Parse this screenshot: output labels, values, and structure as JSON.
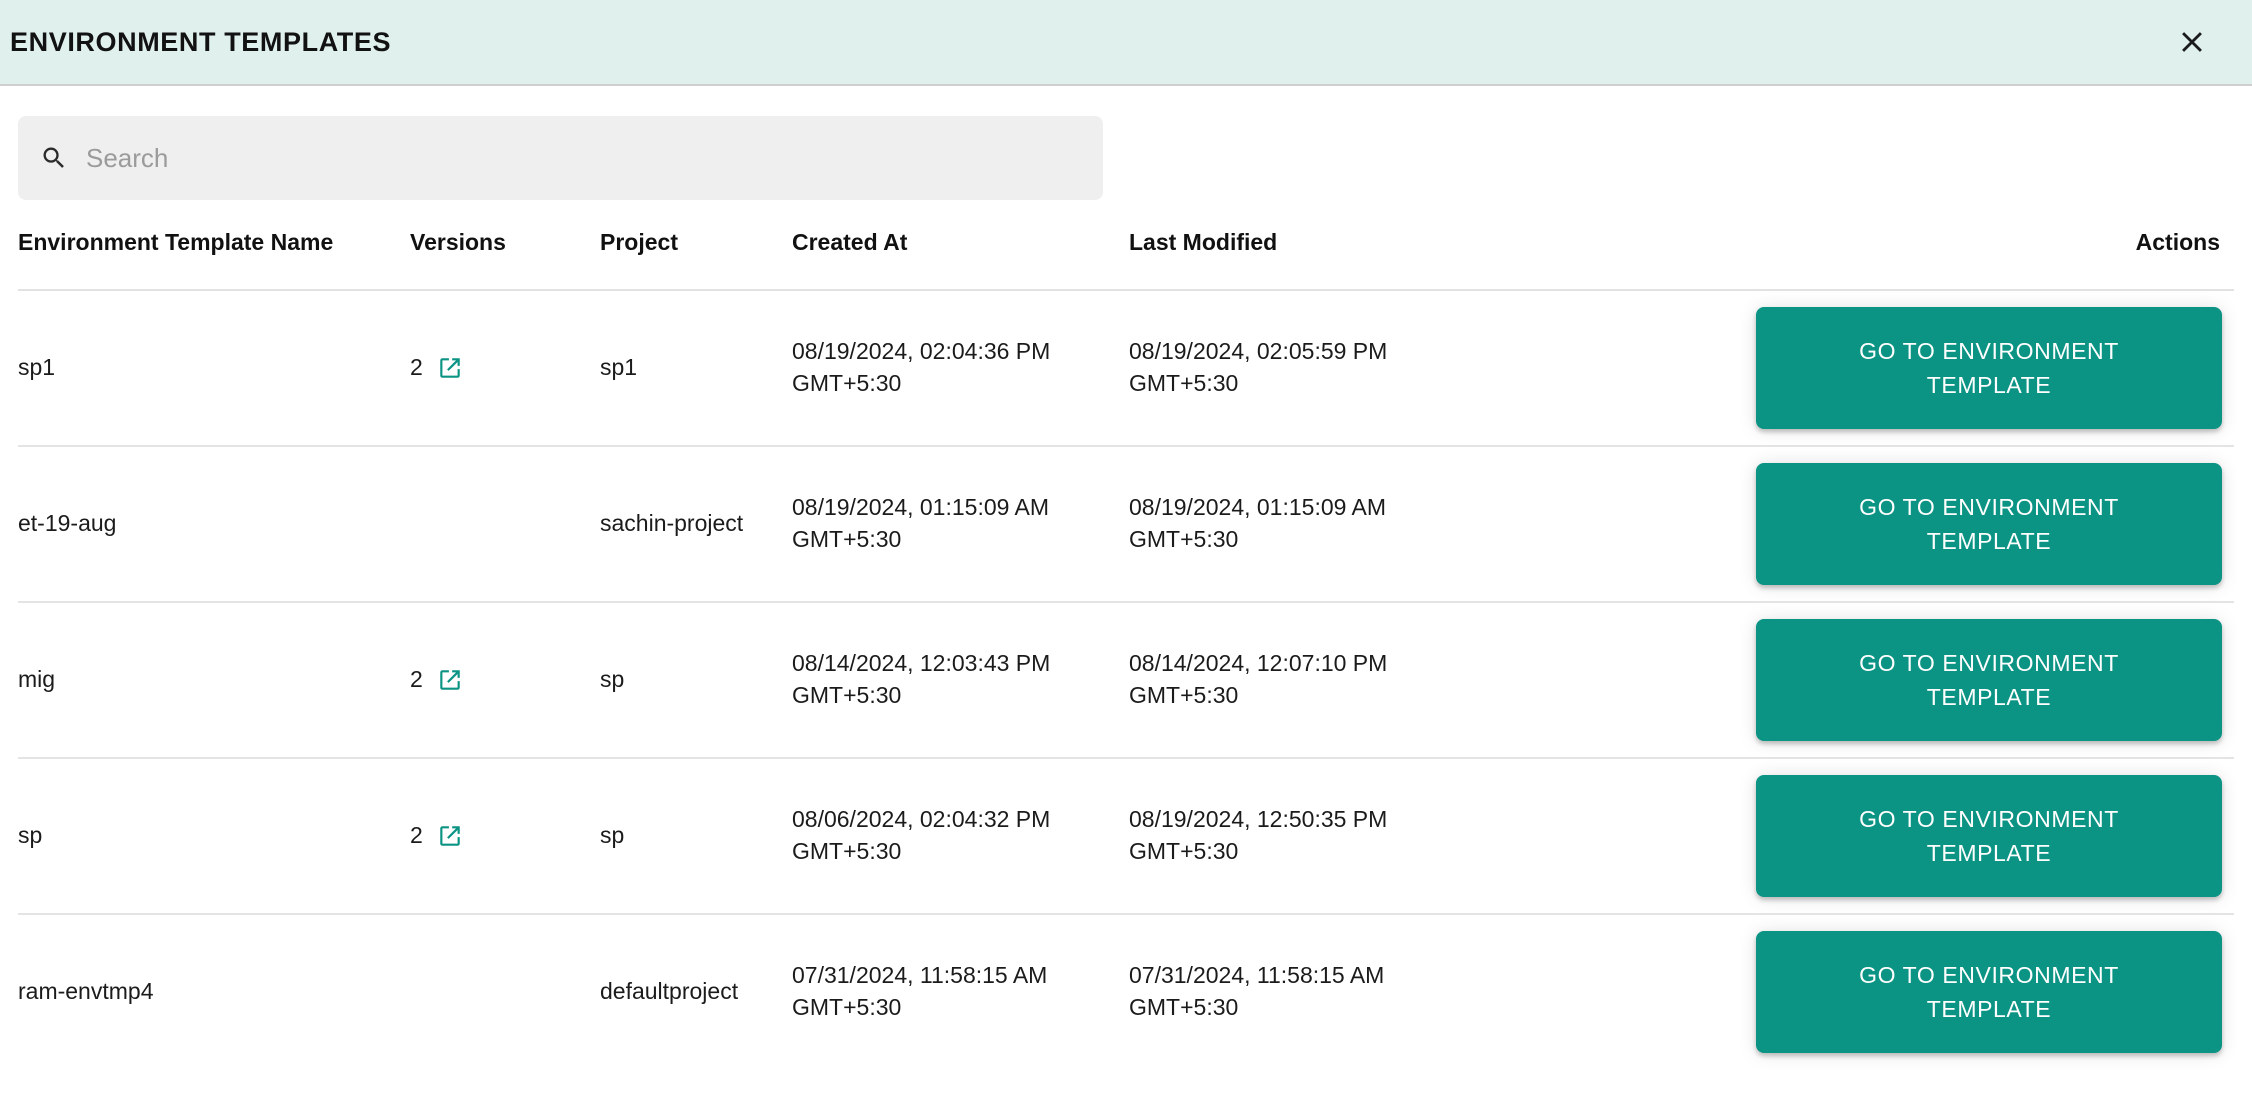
{
  "header": {
    "title": "ENVIRONMENT TEMPLATES",
    "close_icon": "close-icon",
    "background_color": "#dff0ed"
  },
  "search": {
    "placeholder": "Search",
    "value": "",
    "icon": "search-icon"
  },
  "table": {
    "columns": [
      "Environment Template Name",
      "Versions",
      "Project",
      "Created At",
      "Last Modified",
      "Actions"
    ],
    "action_label": "GO TO ENVIRONMENT TEMPLATE",
    "accent_color": "#0b9384",
    "rows": [
      {
        "name": "sp1",
        "versions": "2",
        "has_version_link": true,
        "project": "sp1",
        "created_at": "08/19/2024, 02:04:36 PM GMT+5:30",
        "last_modified": "08/19/2024, 02:05:59 PM GMT+5:30",
        "action": "GO TO ENVIRONMENT TEMPLATE"
      },
      {
        "name": "et-19-aug",
        "versions": "",
        "has_version_link": false,
        "project": "sachin-project",
        "created_at": "08/19/2024, 01:15:09 AM GMT+5:30",
        "last_modified": "08/19/2024, 01:15:09 AM GMT+5:30",
        "action": "GO TO ENVIRONMENT TEMPLATE"
      },
      {
        "name": "mig",
        "versions": "2",
        "has_version_link": true,
        "project": "sp",
        "created_at": "08/14/2024, 12:03:43 PM GMT+5:30",
        "last_modified": "08/14/2024, 12:07:10 PM GMT+5:30",
        "action": "GO TO ENVIRONMENT TEMPLATE"
      },
      {
        "name": "sp",
        "versions": "2",
        "has_version_link": true,
        "project": "sp",
        "created_at": "08/06/2024, 02:04:32 PM GMT+5:30",
        "last_modified": "08/19/2024, 12:50:35 PM GMT+5:30",
        "action": "GO TO ENVIRONMENT TEMPLATE"
      },
      {
        "name": "ram-envtmp4",
        "versions": "",
        "has_version_link": false,
        "project": "defaultproject",
        "created_at": "07/31/2024, 11:58:15 AM GMT+5:30",
        "last_modified": "07/31/2024, 11:58:15 AM GMT+5:30",
        "action": "GO TO ENVIRONMENT TEMPLATE"
      }
    ]
  }
}
